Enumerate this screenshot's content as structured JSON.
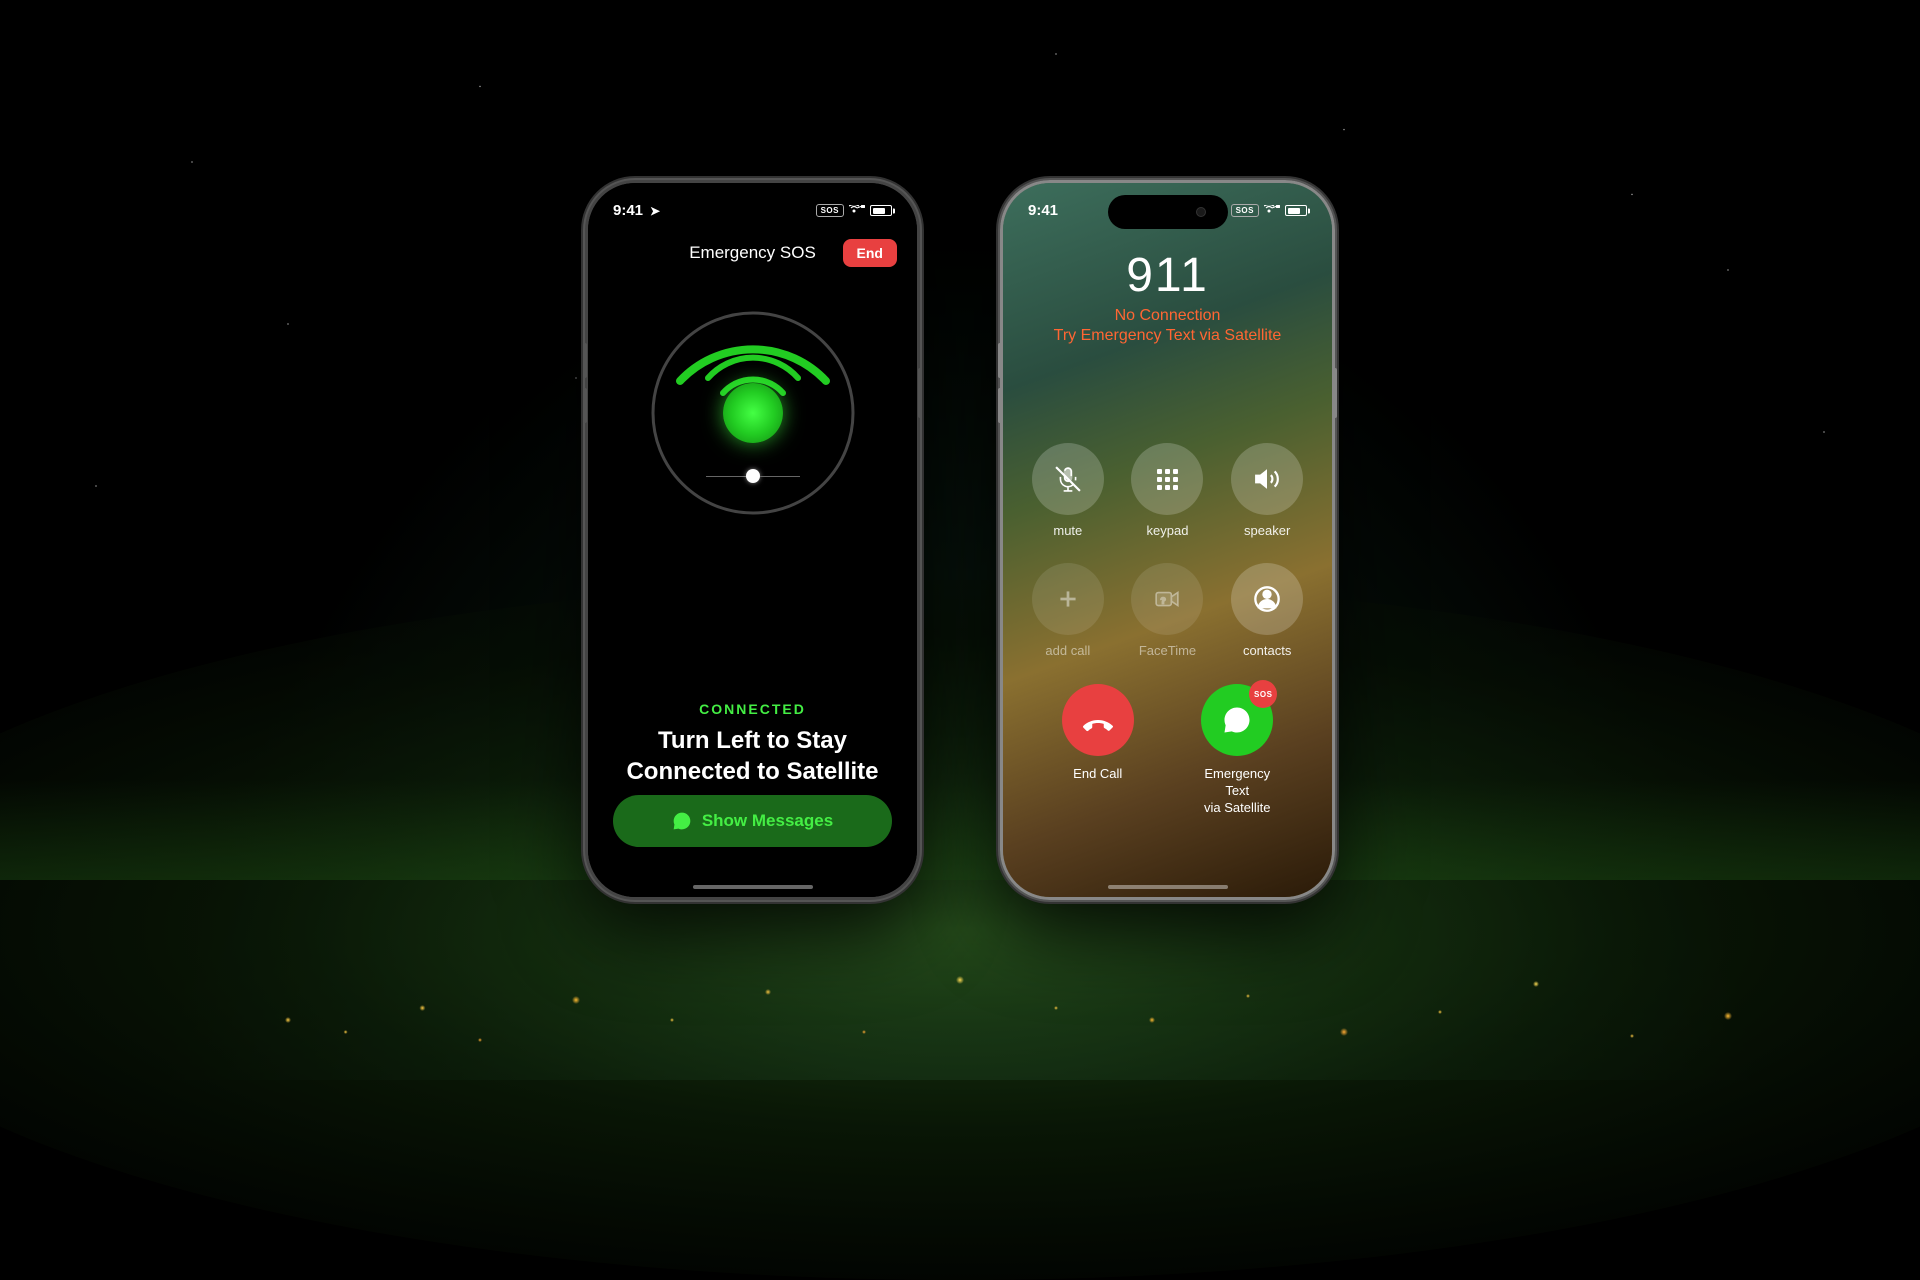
{
  "background": {
    "description": "Earth from space, dark with city lights and horizon glow"
  },
  "phone_left": {
    "status_bar": {
      "time": "9:41",
      "sos_label": "SOS",
      "battery_percent": 75
    },
    "header": {
      "title": "Emergency SOS",
      "end_button": "End"
    },
    "satellite": {
      "status": "CONNECTED",
      "direction": "Turn Left to Stay\nConnected to Satellite"
    },
    "show_messages_button": "Show Messages",
    "home_indicator": true
  },
  "phone_right": {
    "status_bar": {
      "time": "9:41",
      "sos_label": "SOS",
      "battery_percent": 75
    },
    "call": {
      "number": "911",
      "no_connection": "No Connection",
      "try_satellite": "Try Emergency Text via Satellite"
    },
    "controls": [
      {
        "id": "mute",
        "label": "mute",
        "icon": "microphone-slash"
      },
      {
        "id": "keypad",
        "label": "keypad",
        "icon": "keypad-grid"
      },
      {
        "id": "speaker",
        "label": "speaker",
        "icon": "speaker-wave"
      },
      {
        "id": "add-call",
        "label": "add call",
        "icon": "plus",
        "dim": true
      },
      {
        "id": "facetime",
        "label": "FaceTime",
        "icon": "video-question",
        "dim": true
      },
      {
        "id": "contacts",
        "label": "contacts",
        "icon": "person-circle"
      }
    ],
    "actions": [
      {
        "id": "end-call",
        "label": "End Call",
        "type": "end"
      },
      {
        "id": "emergency-text",
        "label": "Emergency Text\nvia Satellite",
        "type": "emergency",
        "sos_badge": "SOS"
      }
    ],
    "home_indicator": true
  }
}
